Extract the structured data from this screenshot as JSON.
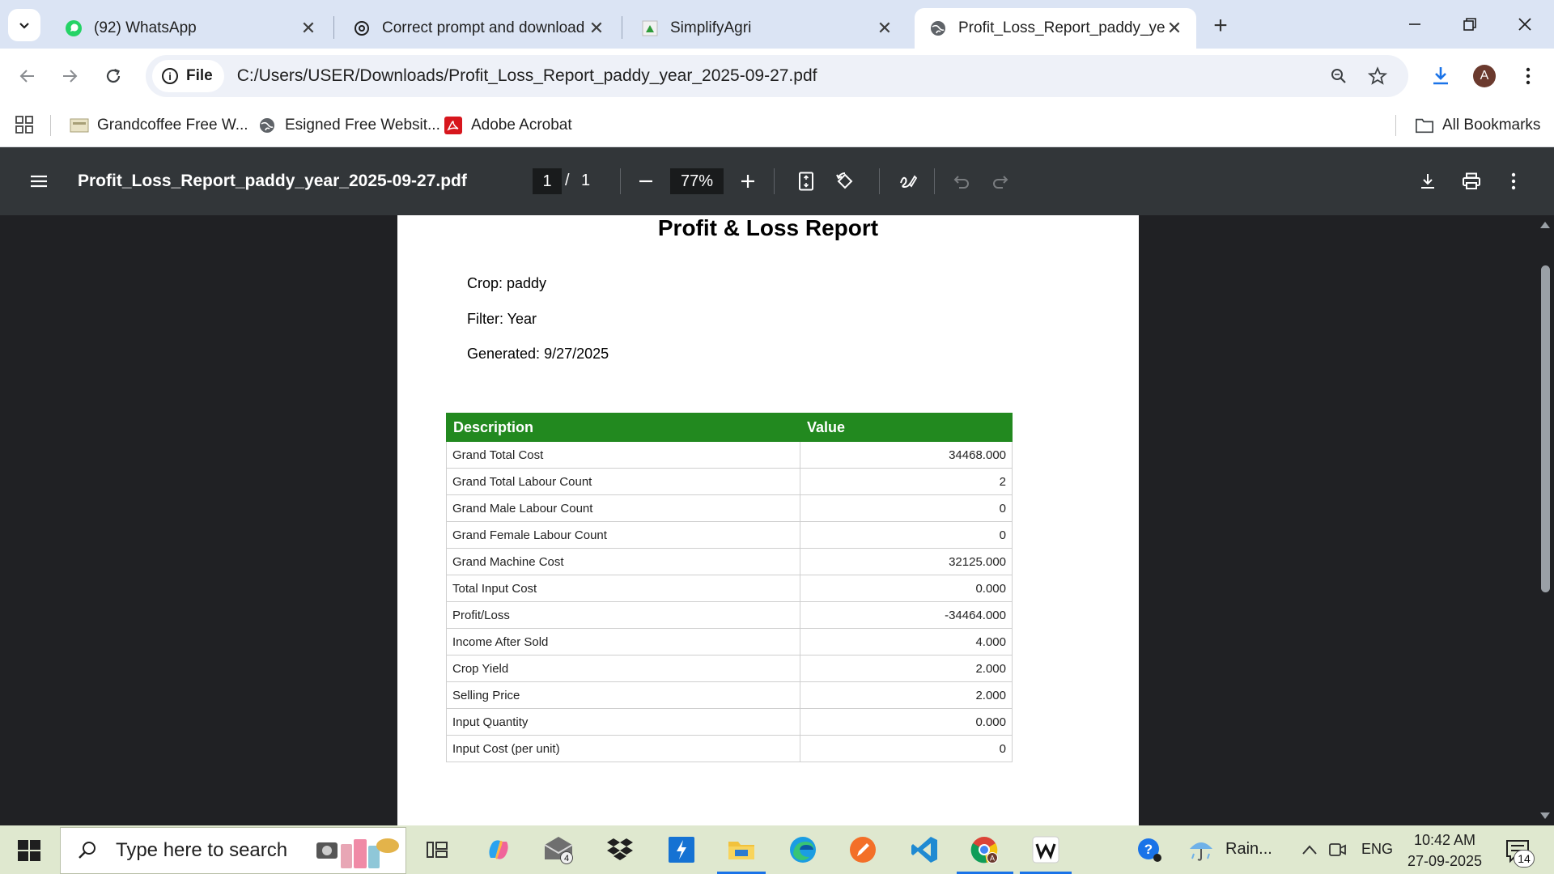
{
  "browser": {
    "tabs": [
      {
        "title": "(92) WhatsApp",
        "icon": "whatsapp-icon",
        "active": false
      },
      {
        "title": "Correct prompt and download f",
        "icon": "chatgpt-icon",
        "active": false
      },
      {
        "title": "SimplifyAgri",
        "icon": "simplifyagri-icon",
        "active": false
      },
      {
        "title": "Profit_Loss_Report_paddy_year_",
        "icon": "globe-icon",
        "active": true
      }
    ],
    "omnibox": {
      "chip_label": "File",
      "url": "C:/Users/USER/Downloads/Profit_Loss_Report_paddy_year_2025-09-27.pdf"
    },
    "profile_initial": "A",
    "bookmarks": [
      {
        "label": "Grandcoffee Free W...",
        "icon": "site-thumb-icon"
      },
      {
        "label": "Esigned Free Websit...",
        "icon": "globe-icon"
      },
      {
        "label": "Adobe Acrobat",
        "icon": "acrobat-icon"
      }
    ],
    "all_bookmarks_label": "All Bookmarks"
  },
  "pdf_viewer": {
    "file_title": "Profit_Loss_Report_paddy_year_2025-09-27.pdf",
    "current_page": "1",
    "page_separator": "/",
    "total_pages": "1",
    "zoom": "77%"
  },
  "report": {
    "title": "Profit & Loss Report",
    "crop_line": "Crop: paddy",
    "filter_line": "Filter: Year",
    "generated_line": "Generated: 9/27/2025",
    "table": {
      "headers": [
        "Description",
        "Value"
      ],
      "header_color": "#22891f",
      "rows": [
        {
          "description": "Grand Total Cost",
          "value": "34468.000"
        },
        {
          "description": "Grand Total Labour Count",
          "value": "2"
        },
        {
          "description": "Grand Male Labour Count",
          "value": "0"
        },
        {
          "description": "Grand Female Labour Count",
          "value": "0"
        },
        {
          "description": "Grand Machine Cost",
          "value": "32125.000"
        },
        {
          "description": "Total Input Cost",
          "value": "0.000"
        },
        {
          "description": "Profit/Loss",
          "value": "-34464.000"
        },
        {
          "description": "Income After Sold",
          "value": "4.000"
        },
        {
          "description": "Crop Yield",
          "value": "2.000"
        },
        {
          "description": "Selling Price",
          "value": "2.000"
        },
        {
          "description": "Input Quantity",
          "value": "0.000"
        },
        {
          "description": "Input Cost (per unit)",
          "value": "0"
        }
      ]
    }
  },
  "taskbar": {
    "search_placeholder": "Type here to search",
    "mail_badge": "4",
    "weather": "Rain...",
    "language": "ENG",
    "time": "10:42 AM",
    "date": "27-09-2025",
    "notification_count": "14"
  }
}
